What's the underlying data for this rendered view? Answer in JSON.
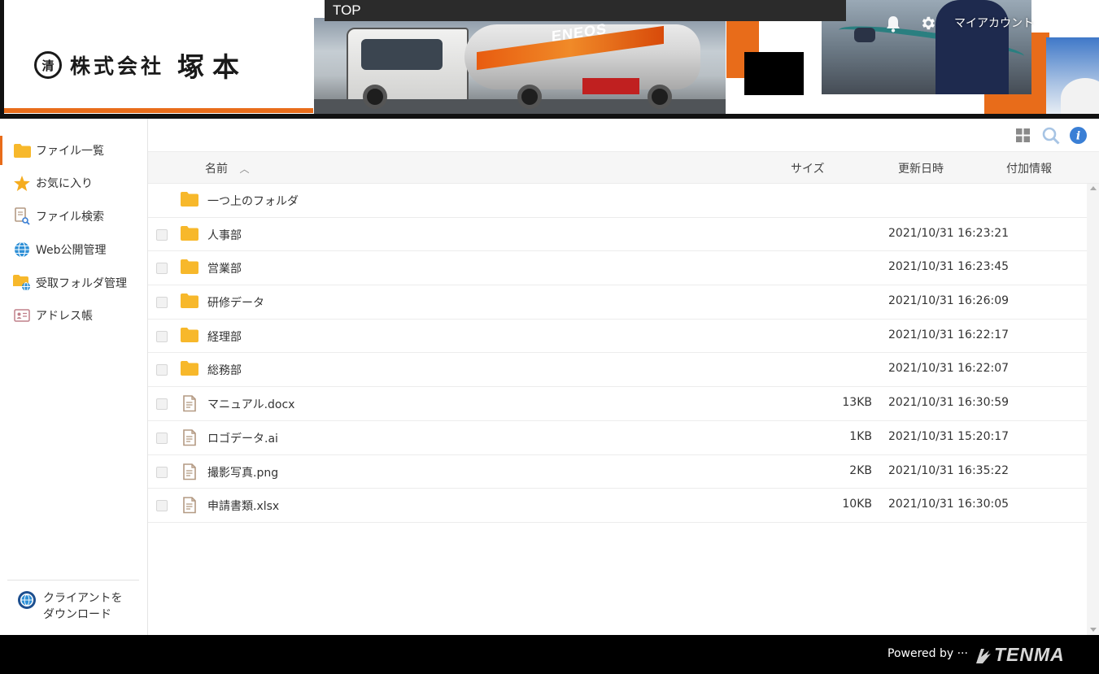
{
  "header": {
    "logo_emblem": "清",
    "company_prefix": "株式会社",
    "company_name": "塚本",
    "top_label": "TOP",
    "truck_brand": "ENEOS",
    "my_account": "マイアカウント"
  },
  "sidebar": {
    "items": [
      {
        "label": "ファイル一覧",
        "icon": "folder-icon",
        "active": true
      },
      {
        "label": "お気に入り",
        "icon": "star-icon",
        "active": false
      },
      {
        "label": "ファイル検索",
        "icon": "file-search-icon",
        "active": false
      },
      {
        "label": "Web公開管理",
        "icon": "globe-icon",
        "active": false
      },
      {
        "label": "受取フォルダ管理",
        "icon": "folder-globe-icon",
        "active": false
      },
      {
        "label": "アドレス帳",
        "icon": "address-card-icon",
        "active": false
      }
    ],
    "client_download": {
      "line1": "クライアントを",
      "line2": "ダウンロード"
    }
  },
  "table": {
    "columns": {
      "name": "名前",
      "size": "サイズ",
      "date": "更新日時",
      "extra": "付加情報"
    },
    "parent_folder": "一つ上のフォルダ",
    "rows": [
      {
        "name": "人事部",
        "type": "folder",
        "size": "",
        "date": "2021/10/31 16:23:21"
      },
      {
        "name": "営業部",
        "type": "folder",
        "size": "",
        "date": "2021/10/31 16:23:45"
      },
      {
        "name": "研修データ",
        "type": "folder",
        "size": "",
        "date": "2021/10/31 16:26:09"
      },
      {
        "name": "経理部",
        "type": "folder",
        "size": "",
        "date": "2021/10/31 16:22:17"
      },
      {
        "name": "総務部",
        "type": "folder",
        "size": "",
        "date": "2021/10/31 16:22:07"
      },
      {
        "name": "マニュアル.docx",
        "type": "file",
        "size": "13KB",
        "date": "2021/10/31 16:30:59"
      },
      {
        "name": "ロゴデータ.ai",
        "type": "file",
        "size": "1KB",
        "date": "2021/10/31 15:20:17"
      },
      {
        "name": "撮影写真.png",
        "type": "file",
        "size": "2KB",
        "date": "2021/10/31 16:35:22"
      },
      {
        "name": "申請書類.xlsx",
        "type": "file",
        "size": "10KB",
        "date": "2021/10/31 16:30:05"
      }
    ]
  },
  "footer": {
    "powered_by": "Powered by ···",
    "brand": "TENMA"
  },
  "colors": {
    "accent": "#e86c1a",
    "folder": "#f7b82b",
    "file_icon": "#b49a83",
    "info": "#3a7fd5"
  }
}
